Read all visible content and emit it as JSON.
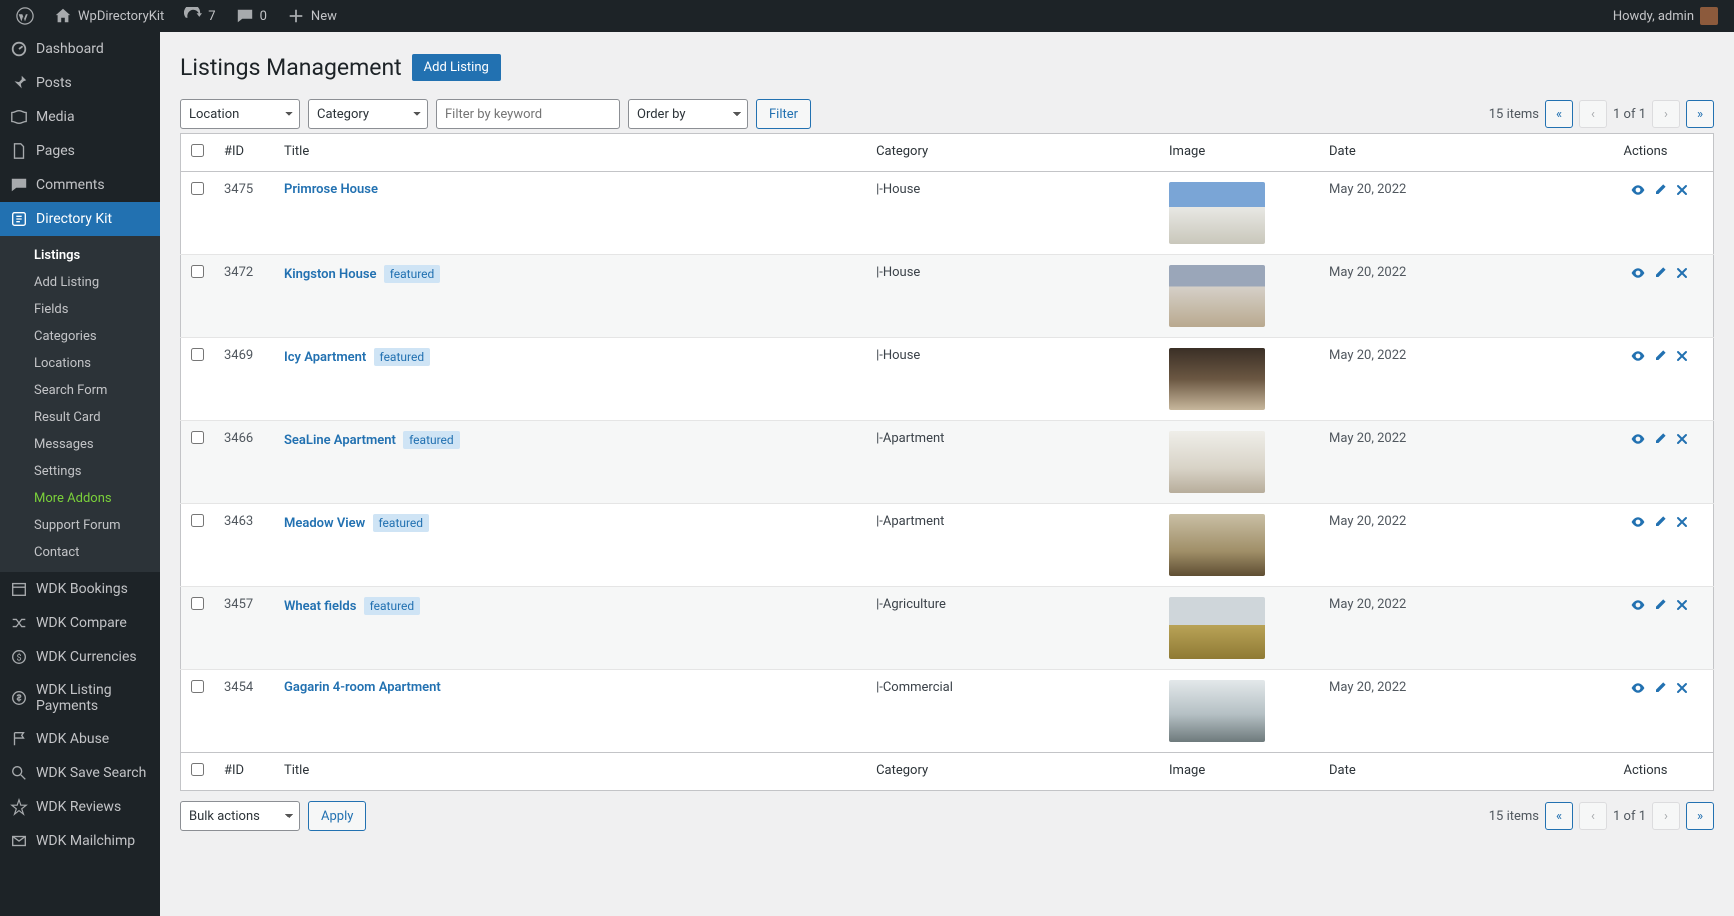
{
  "adminbar": {
    "site_name": "WpDirectoryKit",
    "updates_count": "7",
    "comments_count": "0",
    "new_label": "New",
    "howdy": "Howdy, admin"
  },
  "menu": {
    "dashboard": "Dashboard",
    "posts": "Posts",
    "media": "Media",
    "pages": "Pages",
    "comments": "Comments",
    "directory_kit": "Directory Kit",
    "wdk_bookings": "WDK Bookings",
    "wdk_compare": "WDK Compare",
    "wdk_currencies": "WDK Currencies",
    "wdk_listing_payments": "WDK Listing Payments",
    "wdk_abuse": "WDK Abuse",
    "wdk_save_search": "WDK Save Search",
    "wdk_reviews": "WDK Reviews",
    "wdk_mailchimp": "WDK Mailchimp"
  },
  "submenu": {
    "listings": "Listings",
    "add_listing": "Add Listing",
    "fields": "Fields",
    "categories": "Categories",
    "locations": "Locations",
    "search_form": "Search Form",
    "result_card": "Result Card",
    "messages": "Messages",
    "settings": "Settings",
    "more_addons": "More Addons",
    "support_forum": "Support Forum",
    "contact": "Contact"
  },
  "page": {
    "title": "Listings Management",
    "add_button": "Add Listing"
  },
  "filters": {
    "location": "Location",
    "category": "Category",
    "keyword_placeholder": "Filter by keyword",
    "order_by": "Order by",
    "filter_btn": "Filter"
  },
  "pagination": {
    "items_text": "15 items",
    "first": "«",
    "prev": "‹",
    "page_of": "1 of 1",
    "next": "›",
    "last": "»"
  },
  "columns": {
    "id": "#ID",
    "title": "Title",
    "category": "Category",
    "image": "Image",
    "date": "Date",
    "actions": "Actions"
  },
  "featured_label": "featured",
  "rows": [
    {
      "id": "3475",
      "title": "Primrose House",
      "featured": false,
      "category": "|-House",
      "date": "May 20, 2022",
      "thumb": "house1"
    },
    {
      "id": "3472",
      "title": "Kingston House",
      "featured": true,
      "category": "|-House",
      "date": "May 20, 2022",
      "thumb": "house2"
    },
    {
      "id": "3469",
      "title": "Icy Apartment",
      "featured": true,
      "category": "|-House",
      "date": "May 20, 2022",
      "thumb": "interior1"
    },
    {
      "id": "3466",
      "title": "SeaLine Apartment",
      "featured": true,
      "category": "|-Apartment",
      "date": "May 20, 2022",
      "thumb": "interior2"
    },
    {
      "id": "3463",
      "title": "Meadow View",
      "featured": true,
      "category": "|-Apartment",
      "date": "May 20, 2022",
      "thumb": "interior3"
    },
    {
      "id": "3457",
      "title": "Wheat fields",
      "featured": true,
      "category": "|-Agriculture",
      "date": "May 20, 2022",
      "thumb": "field"
    },
    {
      "id": "3454",
      "title": "Gagarin 4-room Apartment",
      "featured": false,
      "category": "|-Commercial",
      "date": "May 20, 2022",
      "thumb": "building"
    }
  ],
  "bulk": {
    "bulk_actions": "Bulk actions",
    "apply": "Apply"
  }
}
